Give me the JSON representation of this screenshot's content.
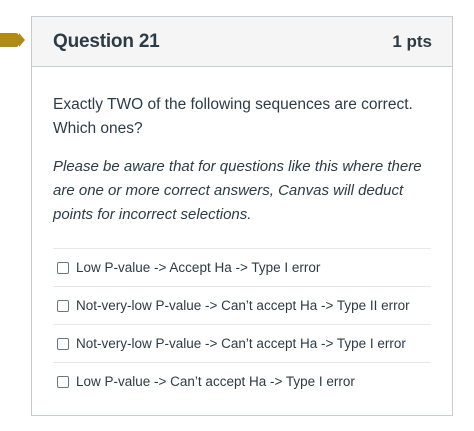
{
  "question": {
    "title": "Question 21",
    "points": "1 pts",
    "prompt": "Exactly TWO  of the following sequences are correct. Which ones?",
    "note": "Please be aware that for questions like this where there are one or more correct answers, Canvas will deduct points for incorrect selections."
  },
  "answers": [
    {
      "label": "Low P-value -> Accept Ha -> Type I error",
      "checked": false
    },
    {
      "label": "Not-very-low P-value -> Can’t accept Ha -> Type II error",
      "checked": false
    },
    {
      "label": "Not-very-low P-value -> Can’t accept Ha -> Type I error",
      "checked": false
    },
    {
      "label": "Low P-value -> Can’t accept Ha -> Type I error",
      "checked": false
    }
  ],
  "colors": {
    "flag": "#b08a14",
    "header_bg": "#f5f5f5",
    "border": "#c7cdd1",
    "text": "#2d3b45"
  },
  "icons": {
    "flag": "bookmark-flag-icon",
    "checkbox": "checkbox-unchecked"
  }
}
